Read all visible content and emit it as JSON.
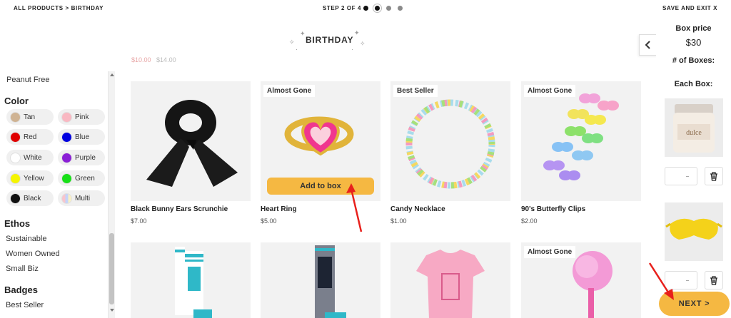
{
  "header": {
    "breadcrumb": "ALL PRODUCTS > BIRTHDAY",
    "step": "STEP 2 OF 4",
    "step_current": 2,
    "step_total": 4,
    "save_exit": "SAVE AND EXIT X"
  },
  "page": {
    "title": "BIRTHDAY",
    "prev_row_price_sale": "$10.00",
    "prev_row_price_orig": "$14.00"
  },
  "sidebar": {
    "top_item": "Peanut Free",
    "color_title": "Color",
    "colors": [
      {
        "label": "Tan",
        "hex": "#cfb393"
      },
      {
        "label": "Pink",
        "hex": "#f9b8c2"
      },
      {
        "label": "Red",
        "hex": "#e00000"
      },
      {
        "label": "Blue",
        "hex": "#0000e0"
      },
      {
        "label": "White",
        "hex": "#ffffff"
      },
      {
        "label": "Purple",
        "hex": "#8a1fd6"
      },
      {
        "label": "Yellow",
        "hex": "#f5f500"
      },
      {
        "label": "Green",
        "hex": "#18e018"
      },
      {
        "label": "Black",
        "hex": "#111111"
      },
      {
        "label": "Multi",
        "hex": "multi"
      }
    ],
    "ethos_title": "Ethos",
    "ethos": [
      "Sustainable",
      "Women Owned",
      "Small Biz"
    ],
    "badges_title": "Badges",
    "badges": [
      "Best Seller"
    ]
  },
  "products": [
    {
      "name": "Black Bunny Ears Scrunchie",
      "price": "$7.00",
      "badge": "",
      "icon": "scrunchie-image"
    },
    {
      "name": "Heart Ring",
      "price": "$5.00",
      "badge": "Almost Gone",
      "icon": "heart-ring-image",
      "add_label": "Add to box"
    },
    {
      "name": "Candy Necklace",
      "price": "$1.00",
      "badge": "Best Seller",
      "icon": "candy-necklace-image"
    },
    {
      "name": "90's Butterfly Clips",
      "price": "$2.00",
      "badge": "Almost Gone",
      "icon": "butterfly-clips-image"
    },
    {
      "name": "",
      "price": "",
      "badge": "",
      "icon": "future-is-female-socks-image"
    },
    {
      "name": "",
      "price": "",
      "badge": "",
      "icon": "too-old-socks-image"
    },
    {
      "name": "",
      "price": "",
      "badge": "",
      "icon": "pink-tshirt-image"
    },
    {
      "name": "",
      "price": "",
      "badge": "Almost Gone",
      "icon": "pink-pom-pen-image"
    }
  ],
  "box_panel": {
    "price_label": "Box price",
    "price": "$30",
    "count_label": "# of Boxes:",
    "each_label": "Each Box:",
    "items": [
      {
        "icon": "dulce-candle-image",
        "brand": "dulce"
      },
      {
        "icon": "yellow-eye-mask-image"
      }
    ],
    "next_label": "NEXT >"
  },
  "colors": {
    "accent": "#f5b842",
    "annotation": "#e8201c"
  }
}
